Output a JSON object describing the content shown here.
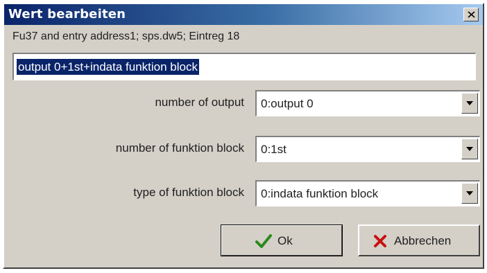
{
  "window": {
    "title": "Wert bearbeiten"
  },
  "info_line": "Fu37 and entry address1; sps.dw5; Eintreg 18",
  "main_input": {
    "value": "output 0+1st+indata funktion block"
  },
  "rows": [
    {
      "label": "number of output",
      "value": "0:output 0"
    },
    {
      "label": "number of funktion block",
      "value": "0:1st"
    },
    {
      "label": "type of funktion block",
      "value": "0:indata funktion block"
    }
  ],
  "buttons": {
    "ok_label": "Ok",
    "cancel_label": "Abbrechen"
  },
  "icons": {
    "close": "close-icon",
    "dropdown": "chevron-down-icon",
    "ok": "checkmark-icon",
    "cancel": "cross-icon"
  },
  "colors": {
    "title_bar_start": "#0a246a",
    "title_bar_end": "#a6caf0",
    "selection": "#0a246a",
    "check": "#2a8a1a",
    "cross": "#c81010"
  }
}
